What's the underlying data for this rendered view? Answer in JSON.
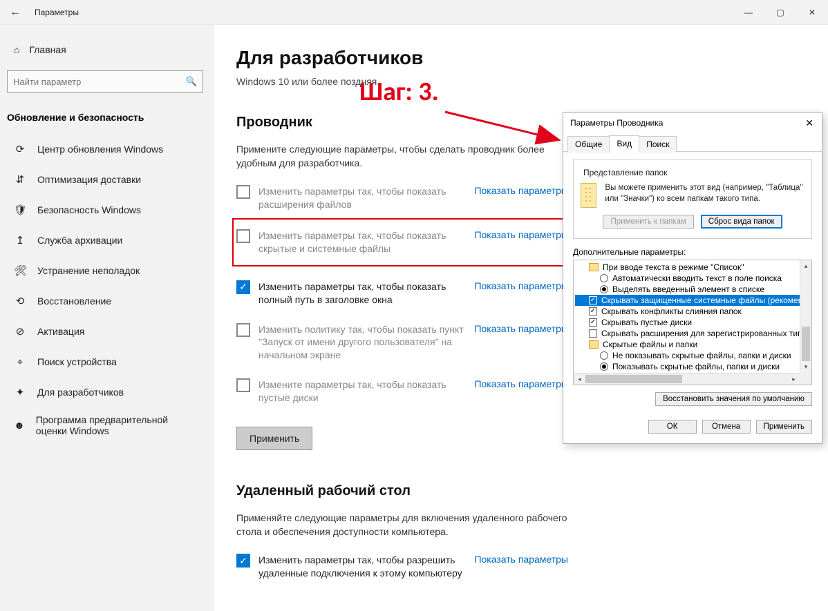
{
  "window": {
    "title": "Параметры"
  },
  "sidebar": {
    "home": "Главная",
    "search_placeholder": "Найти параметр",
    "group": "Обновление и безопасность",
    "items": [
      "Центр обновления Windows",
      "Оптимизация доставки",
      "Безопасность Windows",
      "Служба архивации",
      "Устранение неполадок",
      "Восстановление",
      "Активация",
      "Поиск устройства",
      "Для разработчиков",
      "Программа предварительной оценки Windows"
    ]
  },
  "content": {
    "h1": "Для разработчиков",
    "sub": "Windows 10 или более поздняя.",
    "explorer_h2": "Проводник",
    "explorer_desc": "Примените следующие параметры, чтобы сделать проводник более удобным для разработчика.",
    "link_label": "Показать параметры",
    "apply": "Применить",
    "opts": [
      "Изменить параметры так, чтобы показать расширения файлов",
      "Изменить параметры так, чтобы показать скрытые и системные файлы",
      "Изменить параметры так, чтобы показать полный путь в заголовке окна",
      "Изменить политику так, чтобы показать пункт \"Запуск от имени другого пользователя\" на начальном экране",
      "Измените параметры так, чтобы показать пустые диски"
    ],
    "rdp_h2": "Удаленный рабочий стол",
    "rdp_desc": "Применяйте следующие параметры для включения удаленного рабочего стола и обеспечения доступности компьютера.",
    "rdp_opt": "Изменить параметры так, чтобы разрешить удаленные подключения к этому компьютеру"
  },
  "annotation": {
    "step": "Шаг: 3."
  },
  "dialog": {
    "title": "Параметры Проводника",
    "tabs": [
      "Общие",
      "Вид",
      "Поиск"
    ],
    "fieldset_legend": "Представление папок",
    "fieldset_text": "Вы можете применить этот вид (например, \"Таблица\" или \"Значки\") ко всем папкам такого типа.",
    "apply_folders": "Применить к папкам",
    "reset_folders": "Сброс вида папок",
    "advanced_label": "Дополнительные параметры:",
    "tree": {
      "g1": "При вводе текста в режиме \"Список\"",
      "r1": "Автоматически вводить текст в поле поиска",
      "r2": "Выделять введенный элемент в списке",
      "c1": "Скрывать защищенные системные файлы (рекомен",
      "c2": "Скрывать конфликты слияния папок",
      "c3": "Скрывать пустые диски",
      "c4": "Скрывать расширения для зарегистрированных типо",
      "g2": "Скрытые файлы и папки",
      "r3": "Не показывать скрытые файлы, папки и диски",
      "r4": "Показывать скрытые файлы, папки и диски"
    },
    "restore": "Восстановить значения по умолчанию",
    "ok": "ОК",
    "cancel": "Отмена",
    "apply": "Применить"
  }
}
